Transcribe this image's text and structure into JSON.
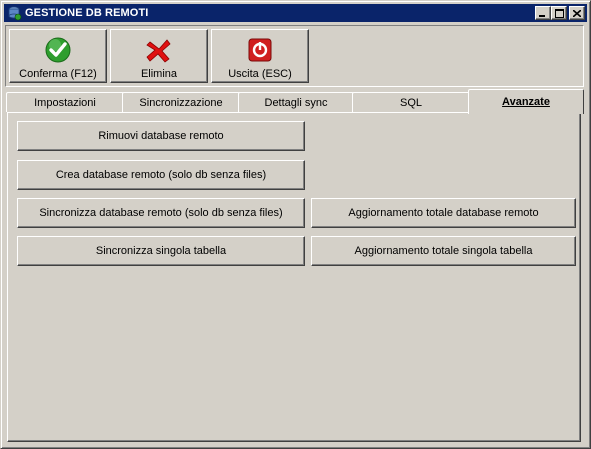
{
  "window": {
    "title": "GESTIONE DB REMOTI"
  },
  "toolbar": {
    "buttons": [
      {
        "label": "Conferma (F12)",
        "icon": "check-icon"
      },
      {
        "label": "Elimina",
        "icon": "delete-x-icon"
      },
      {
        "label": "Uscita (ESC)",
        "icon": "exit-icon"
      }
    ]
  },
  "tabs": [
    {
      "label": "Impostazioni",
      "active": false
    },
    {
      "label": "Sincronizzazione",
      "active": false
    },
    {
      "label": "Dettagli sync",
      "active": false
    },
    {
      "label": "SQL",
      "active": false
    },
    {
      "label": "Avanzate",
      "active": true
    }
  ],
  "advanced": {
    "remove_db": "Rimuovi database remoto",
    "create_db": "Crea database remoto (solo db senza files)",
    "sync_db": "Sincronizza database remoto (solo db senza files)",
    "full_update_db": "Aggiornamento totale database remoto",
    "sync_table": "Sincronizza singola tabella",
    "full_update_table": "Aggiornamento totale singola tabella"
  },
  "colors": {
    "titlebar": "#0a246a",
    "face": "#d4d0c8",
    "check_green": "#2e9e2e",
    "delete_red": "#e01010",
    "exit_red": "#d02020"
  }
}
